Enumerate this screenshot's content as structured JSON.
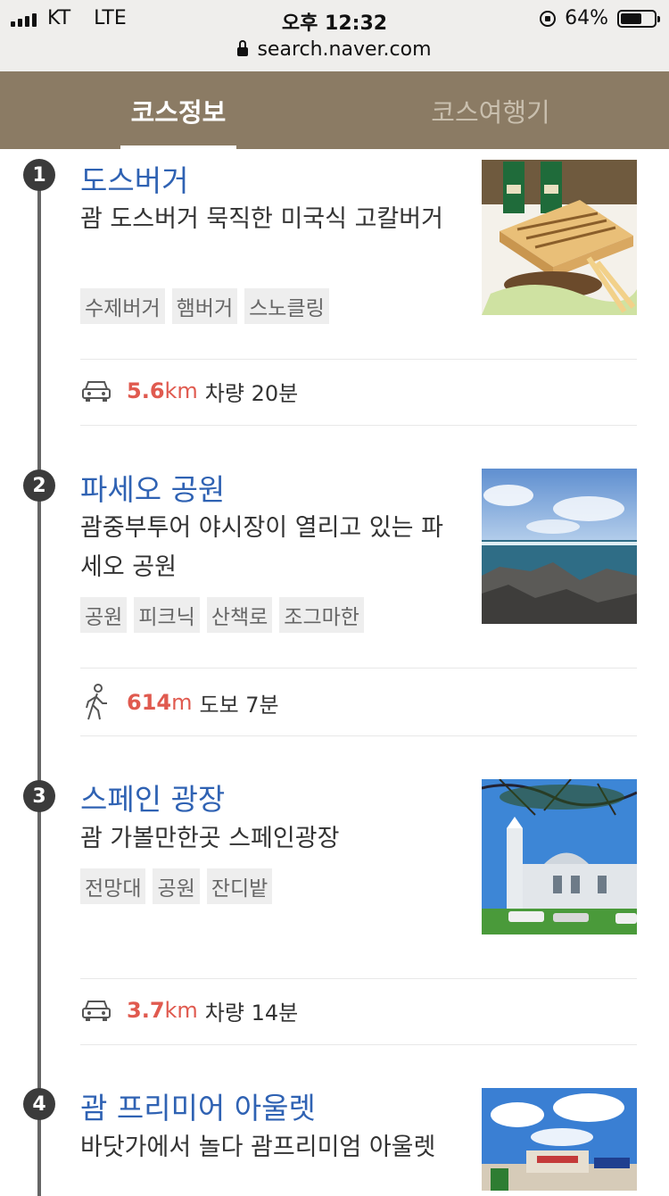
{
  "status_bar": {
    "carrier": "KT",
    "network": "LTE",
    "time": "오후 12:32",
    "battery_percent_text": "64%",
    "battery_level": 0.64
  },
  "url_bar": {
    "url": "search.naver.com"
  },
  "tabs": [
    {
      "label": "코스정보",
      "active": true
    },
    {
      "label": "코스여행기",
      "active": false
    }
  ],
  "course": [
    {
      "number": "1",
      "title": "도스버거",
      "description": "괌 도스버거 묵직한 미국식 고칼버거",
      "tags": [
        "수제버거",
        "햄버거",
        "스노클링"
      ],
      "image": "burger-photo"
    },
    {
      "number": "2",
      "title": "파세오 공원",
      "description": "괌중부투어 야시장이 열리고 있는 파세오 공원",
      "tags": [
        "공원",
        "피크닉",
        "산책로",
        "조그마한"
      ],
      "image": "seaside-rocks-photo"
    },
    {
      "number": "3",
      "title": "스페인 광장",
      "description": "괌 가볼만한곳 스페인광장",
      "tags": [
        "전망대",
        "공원",
        "잔디밭"
      ],
      "image": "cathedral-photo"
    },
    {
      "number": "4",
      "title": "괌 프리미어 아울렛",
      "description": "바닷가에서 놀다 괌프리미엄 아울렛",
      "tags": [],
      "image": "outlet-mall-photo"
    }
  ],
  "transports": [
    {
      "mode": "car",
      "icon": "car-icon",
      "distance_value": "5.6",
      "distance_unit": "km",
      "detail": "차량 20분"
    },
    {
      "mode": "walk",
      "icon": "walking-person-icon",
      "distance_value": "614",
      "distance_unit": "m",
      "detail": "도보 7분"
    },
    {
      "mode": "car",
      "icon": "car-icon",
      "distance_value": "3.7",
      "distance_unit": "km",
      "detail": "차량 14분"
    }
  ],
  "colors": {
    "tab_bar": "#8b7b64",
    "title_blue": "#2f62b3",
    "distance_red": "#e05a4f",
    "timeline": "#3b3b3b"
  }
}
